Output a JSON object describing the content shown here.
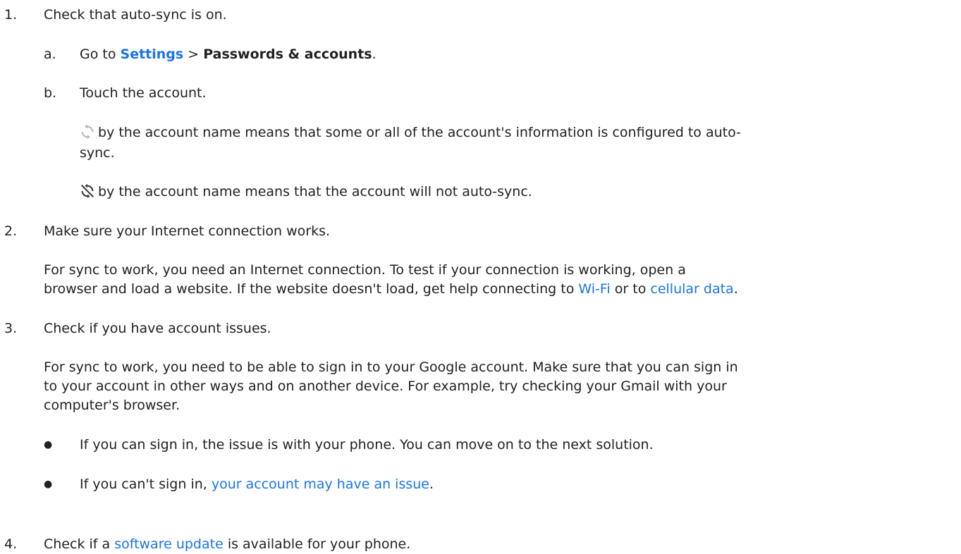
{
  "steps": [
    {
      "num": "1.",
      "text": "Check that auto-sync is on."
    },
    {
      "num": "2.",
      "text": "Make sure your Internet connection works."
    },
    {
      "num": "3.",
      "text": "Check if you have account issues."
    },
    {
      "num": "4.",
      "text_before": "Check if a ",
      "link": "software update",
      "text_after": " is available for your phone."
    }
  ],
  "substeps": {
    "a": {
      "letter": "a.",
      "prefix": "Go to ",
      "settings": "Settings",
      "sep": " > ",
      "passwords": "Passwords & accounts",
      "end": "."
    },
    "b": {
      "letter": "b.",
      "text": "Touch the account."
    }
  },
  "sync_note": {
    "line1": "by the account name means that some or all of the account's information is configured to auto-",
    "line2": "sync.",
    "off_text": "by the account name means that the account will not auto-sync."
  },
  "step2_para": {
    "line1": "For sync to work, you need an Internet connection. To test if your connection is working, open a",
    "line2_before": "browser and load a website. If the website doesn't load, get help connecting to ",
    "wifi_link": "Wi-Fi",
    "line2_mid": " or to ",
    "cellular_link": "cellular data",
    "line2_end": "."
  },
  "step3_para": {
    "line1": "For sync to work, you need to be able to sign in to your Google account. Make sure that you can sign in",
    "line2": "to your account in other ways and on another device. For example, try checking your Gmail with your",
    "line3": "computer's browser."
  },
  "bullets": [
    {
      "text": "If you can sign in, the issue is with your phone. You can move on to the next solution."
    },
    {
      "before": "If you can't sign in, ",
      "link": "your account may have an issue",
      "after": "."
    }
  ],
  "icons": {
    "sync": "sync-icon",
    "sync_off": "sync-off-icon"
  },
  "colors": {
    "link": "#1a73e8",
    "text": "#202124"
  }
}
